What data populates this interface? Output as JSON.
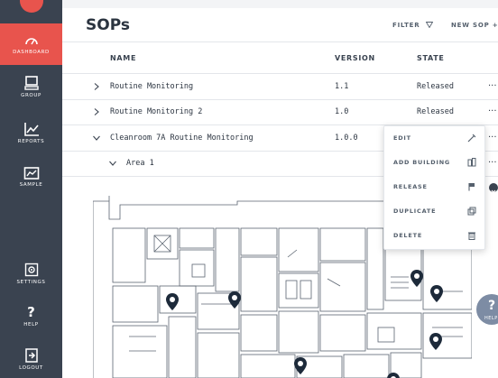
{
  "sidebar": {
    "items": [
      {
        "label": "DASHBOARD",
        "icon": "dashboard-icon"
      },
      {
        "label": "GROUP",
        "icon": "monitor-icon"
      },
      {
        "label": "REPORTS",
        "icon": "chart-icon"
      },
      {
        "label": "SAMPLE",
        "icon": "sample-icon"
      },
      {
        "label": "SETTINGS",
        "icon": "gear-icon"
      },
      {
        "label": "HELP",
        "icon": "question-icon"
      },
      {
        "label": "LOGOUT",
        "icon": "logout-icon"
      }
    ],
    "active_color": "#e8544d",
    "bg_color": "#3a4350"
  },
  "header": {
    "title": "SOPs",
    "filter_label": "FILTER",
    "new_sop_label": "NEW SOP +"
  },
  "table": {
    "columns": [
      "NAME",
      "VERSION",
      "STATE"
    ],
    "rows": [
      {
        "name": "Routine Monitoring",
        "version": "1.1",
        "state": "Released",
        "more": "..."
      },
      {
        "name": "Routine Monitoring 2",
        "version": "1.0",
        "state": "Released",
        "more": "..."
      },
      {
        "name": "Cleanroom 7A Routine Monitoring",
        "version": "1.0.0",
        "state": "",
        "more": "..."
      }
    ],
    "subrow": {
      "name": "Area 1",
      "more": "..."
    }
  },
  "context_menu": {
    "items": [
      {
        "label": "EDIT",
        "icon": "pencil-icon"
      },
      {
        "label": "ADD BUILDING",
        "icon": "building-icon"
      },
      {
        "label": "RELEASE",
        "icon": "flag-icon"
      },
      {
        "label": "DUPLICATE",
        "icon": "duplicate-icon"
      },
      {
        "label": "DELETE",
        "icon": "trash-icon"
      }
    ]
  },
  "help_fab": {
    "symbol": "?",
    "label": "HELP"
  }
}
